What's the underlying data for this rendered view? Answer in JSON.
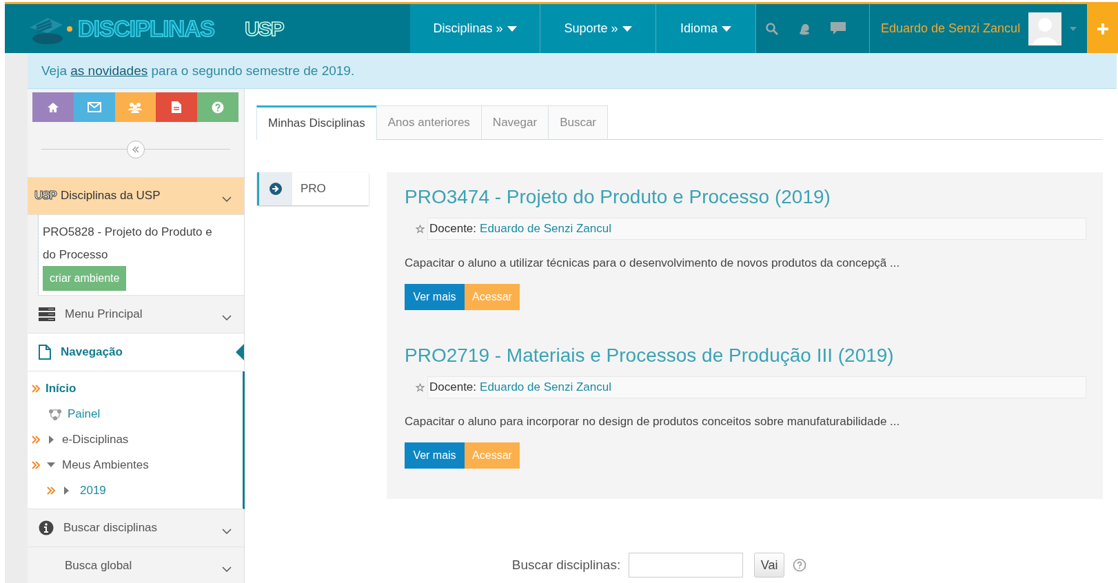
{
  "header": {
    "logo_text": "DISCIPLINAS",
    "usp_logo": "USP",
    "menus": [
      {
        "label": "Disciplinas »"
      },
      {
        "label": "Suporte »"
      },
      {
        "label": "Idioma"
      }
    ],
    "user_name": "Eduardo de Senzi Zancul"
  },
  "notice": {
    "before": "Veja ",
    "link": "as novidades",
    "after": " para o segundo semestre de 2019."
  },
  "sidebar": {
    "blocks": [
      {
        "kind": "usp",
        "logo": "USP",
        "title": "Disciplinas da USP",
        "active": false,
        "items": [
          {
            "name": "PRO5828 - Projeto do Produto e do Processo",
            "action": "criar ambiente"
          }
        ]
      },
      {
        "kind": "menu",
        "title": "Menu Principal",
        "active": false
      },
      {
        "kind": "navigation",
        "title": "Navegação",
        "active": true,
        "tree": [
          {
            "kind": "home",
            "label": "Início",
            "marked": true,
            "children": [
              {
                "kind": "dashboard",
                "label": "Painel",
                "marked": false
              },
              {
                "kind": "branch",
                "label": "e-Disciplinas",
                "marked": true,
                "expanded": false
              },
              {
                "kind": "branch",
                "label": "Meus Ambientes",
                "marked": true,
                "expanded": true,
                "children": [
                  {
                    "kind": "category",
                    "label": "2019",
                    "marked": true,
                    "expanded": false
                  }
                ]
              }
            ]
          }
        ]
      },
      {
        "kind": "info",
        "title": "Buscar disciplinas",
        "active": false
      },
      {
        "kind": "plain",
        "title": "Busca global",
        "active": false
      }
    ]
  },
  "tabs": [
    {
      "label": "Minhas Disciplinas",
      "selected": true
    },
    {
      "label": "Anos anteriores",
      "selected": false
    },
    {
      "label": "Navegar",
      "selected": false
    },
    {
      "label": "Buscar",
      "selected": false
    }
  ],
  "filter": {
    "label": "PRO"
  },
  "courses": [
    {
      "title": "PRO3474 - Projeto do Produto e Processo (2019)",
      "teacher_label": "Docente:",
      "teacher": "Eduardo de Senzi Zancul",
      "description": "Capacitar o aluno a utilizar técnicas para o desenvolvimento de novos produtos da concepçã ...",
      "more": "Ver mais",
      "access": "Acessar"
    },
    {
      "title": "PRO2719 - Materiais e Processos de Produção III (2019)",
      "teacher_label": "Docente:",
      "teacher": "Eduardo de Senzi Zancul",
      "description": "Capacitar o aluno para incorporar no design de produtos conceitos sobre manufaturabilidade ...",
      "more": "Ver mais",
      "access": "Acessar"
    }
  ],
  "search": {
    "label": "Buscar disciplinas:",
    "button": "Vai"
  }
}
